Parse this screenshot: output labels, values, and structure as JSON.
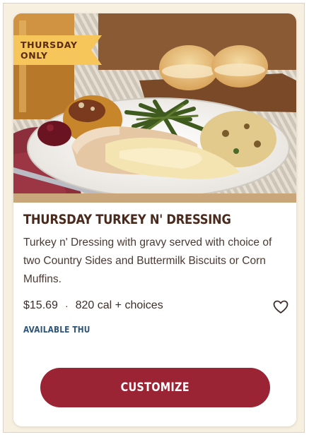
{
  "promo": {
    "badge": "THURSDAY ONLY",
    "image_alt": "Turkey n' Dressing plate with green beans, cranberry relish, corn muffin and buttermilk biscuits"
  },
  "item": {
    "title": "THURSDAY TURKEY N' DRESSING",
    "description": "Turkey n' Dressing with gravy served with choice of two Country Sides and Buttermilk Biscuits or Corn Muffins.",
    "price": "$15.69",
    "separator": "·",
    "calories": "820 cal + choices",
    "availability": "AVAILABLE THU",
    "favorite_icon": "heart-outline-icon",
    "cta_label": "CUSTOMIZE"
  },
  "colors": {
    "badge_bg": "#f7c65a",
    "badge_text": "#5a2a14",
    "title": "#4a2a1c",
    "availability": "#2e5477",
    "cta_bg": "#9a2334",
    "page_bg": "#f7efe0"
  }
}
